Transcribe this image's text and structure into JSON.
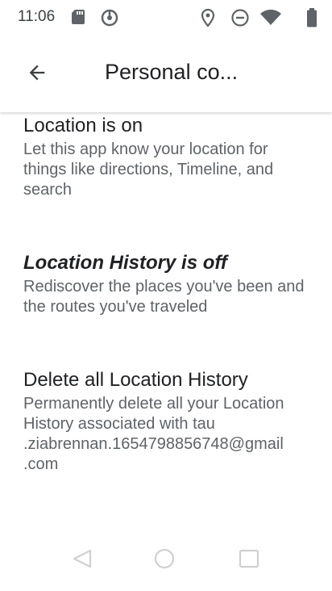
{
  "status_bar": {
    "time": "11:06",
    "icons": [
      "sd-card-icon",
      "sync-icon",
      "location-icon",
      "do-not-disturb-icon",
      "wifi-icon",
      "battery-icon"
    ]
  },
  "app_bar": {
    "title": "Personal co...",
    "back_icon": "arrow-back-icon"
  },
  "settings": [
    {
      "title": "Location is on",
      "description": "Let this app know your location for things like directions, Timeline, and search"
    },
    {
      "title": "Location History is off",
      "description": "Rediscover the places you've been and the routes you've traveled"
    },
    {
      "title": "Delete all Location History",
      "description": "Permanently delete all your Location History associated with tau .ziabrennan.1654798856748@gmail .com"
    }
  ],
  "nav_bar": {
    "icons": [
      "back-nav-icon",
      "home-nav-icon",
      "recents-nav-icon"
    ]
  },
  "colors": {
    "text_primary": "#202124",
    "text_secondary": "#5f6368",
    "background": "#ffffff"
  }
}
